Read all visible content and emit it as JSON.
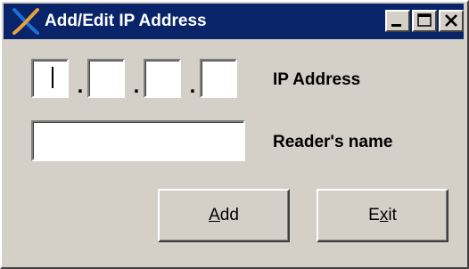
{
  "window": {
    "title": "Add/Edit IP Address",
    "icon": "x-logo-icon",
    "controls": {
      "minimize_icon": "minimize-icon",
      "maximize_icon": "maximize-icon",
      "close_icon": "close-icon"
    }
  },
  "form": {
    "ip_octets": [
      "",
      "",
      "",
      ""
    ],
    "separator": ".",
    "ip_label": "IP Address",
    "reader_name_value": "",
    "reader_name_label": "Reader's name"
  },
  "buttons": {
    "add": {
      "mnemonic": "A",
      "rest": "dd"
    },
    "exit": {
      "pre": "E",
      "mnemonic": "x",
      "rest": "it"
    }
  },
  "colors": {
    "titlebar": "#0a246a",
    "face": "#d4d0c8",
    "title_text": "#ffffff",
    "logo_blue": "#1e6fd6",
    "logo_orange": "#e8a23a"
  }
}
